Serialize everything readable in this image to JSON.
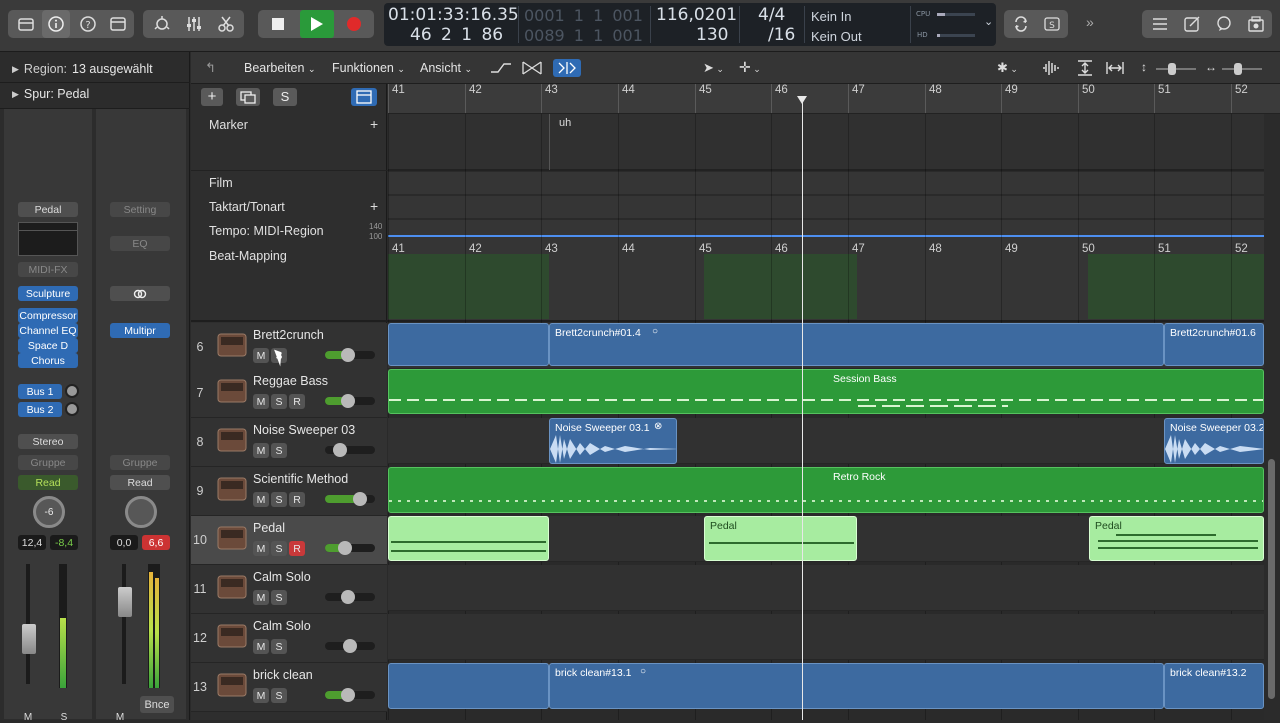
{
  "transport": {
    "position_time": "01:01:33:16.35",
    "position_bars": "46  2  1    86",
    "end_time": "0001  1  1   001",
    "end_bars": "0089  1  1   001",
    "tempo": "116,0201",
    "tempo_bpm": "130",
    "signature": "4/4",
    "division": "/16",
    "in_label": "Kein In",
    "out_label": "Kein Out",
    "cpu_label": "CPU",
    "hd_label": "HD"
  },
  "inspector": {
    "region_label": "Region:",
    "region_value": "13 ausgewählt",
    "track_label": "Spur: Pedal",
    "strip1": {
      "name": "Pedal",
      "midifx": "MIDI-FX",
      "instrument": "Sculpture",
      "inserts": [
        "Compressor",
        "Channel EQ",
        "Space D",
        "Chorus"
      ],
      "sends": [
        "Bus 1",
        "Bus 2"
      ],
      "output": "Stereo",
      "group": "Gruppe",
      "automation": "Read",
      "pan": "-6",
      "level": "12,4",
      "peak": "-8,4",
      "mute": "M",
      "solo": "S"
    },
    "strip2": {
      "setting": "Setting",
      "eq": "EQ",
      "insert": "Multipr",
      "group": "Gruppe",
      "automation": "Read",
      "level": "0,0",
      "peak": "6,6",
      "mute": "M",
      "bounce": "Bnce"
    }
  },
  "menubar": {
    "edit": "Bearbeiten",
    "functions": "Funktionen",
    "view": "Ansicht"
  },
  "globals": {
    "marker": "Marker",
    "marker_text": "uh",
    "film": "Film",
    "signature": "Taktart/Tonart",
    "tempo": "Tempo: MIDI-Region",
    "tempo_hi": "140",
    "tempo_lo": "100",
    "beatmapping": "Beat-Mapping"
  },
  "ruler": [
    "41",
    "42",
    "43",
    "44",
    "45",
    "46",
    "47",
    "48",
    "49",
    "50",
    "51",
    "52"
  ],
  "tracks": [
    {
      "num": "6",
      "name": "Brett2crunch",
      "buttons": [
        "M",
        "S"
      ],
      "volume": 0.45
    },
    {
      "num": "7",
      "name": "Reggae Bass",
      "buttons": [
        "M",
        "S",
        "R"
      ],
      "volume": 0.45
    },
    {
      "num": "8",
      "name": "Noise Sweeper 03",
      "buttons": [
        "M",
        "S"
      ],
      "volume": 0.3
    },
    {
      "num": "9",
      "name": "Scientific Method",
      "buttons": [
        "M",
        "S",
        "R"
      ],
      "volume": 0.7
    },
    {
      "num": "10",
      "name": "Pedal",
      "buttons": [
        "M",
        "S",
        "R"
      ],
      "volume": 0.4
    },
    {
      "num": "11",
      "name": "Calm Solo",
      "buttons": [
        "M",
        "S"
      ],
      "volume": 0.45
    },
    {
      "num": "12",
      "name": "Calm Solo",
      "buttons": [
        "M",
        "S"
      ],
      "volume": 0.5
    },
    {
      "num": "13",
      "name": "brick clean",
      "buttons": [
        "M",
        "S"
      ],
      "volume": 0.45
    }
  ],
  "regions": {
    "brett_a": "Brett2crunch#01.4",
    "brett_b": "Brett2crunch#01.6",
    "bass": "Session Bass",
    "noise_a": "Noise Sweeper 03.1",
    "noise_b": "Noise Sweeper 03.2",
    "drums": "Retro Rock",
    "pedal_a": "Pedal",
    "pedal_b": "Pedal",
    "brick_a": "brick clean#13.1",
    "brick_b": "brick clean#13.2"
  },
  "colors": {
    "audio_region": "#3d6aa0",
    "midi_region": "#2d9a39",
    "selected_midi": "#a7eca0",
    "accent_blue": "#2f6bb4",
    "record_red": "#c9393a"
  }
}
